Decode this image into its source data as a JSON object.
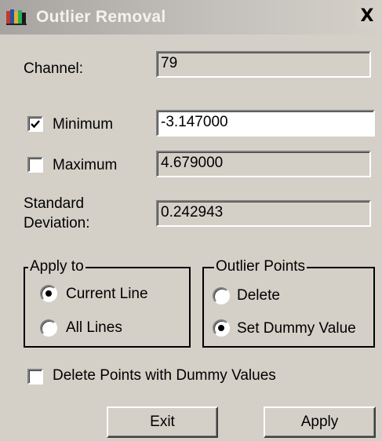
{
  "window": {
    "title": "Outlier Removal",
    "close_glyph": "X",
    "icon": "app-icon"
  },
  "channel": {
    "label": "Channel:",
    "value": "79"
  },
  "minimum": {
    "label": "Minimum",
    "checked": true,
    "value": "-3.147000"
  },
  "maximum": {
    "label": "Maximum",
    "checked": false,
    "value": "4.679000"
  },
  "std_dev": {
    "label_line1": "Standard",
    "label_line2": "Deviation:",
    "value": "0.242943"
  },
  "apply_to": {
    "title": "Apply to",
    "options": [
      {
        "label": "Current Line",
        "selected": true
      },
      {
        "label": "All Lines",
        "selected": false
      }
    ]
  },
  "outlier_points": {
    "title": "Outlier Points",
    "options": [
      {
        "label": "Delete",
        "selected": false
      },
      {
        "label": "Set Dummy Value",
        "selected": true
      }
    ]
  },
  "delete_dummy": {
    "label": "Delete Points with Dummy Values",
    "checked": false
  },
  "buttons": {
    "exit": "Exit",
    "apply": "Apply"
  },
  "colors": {
    "dialog_bg": "#d4d0c8",
    "field_editable_bg": "#ffffff"
  }
}
